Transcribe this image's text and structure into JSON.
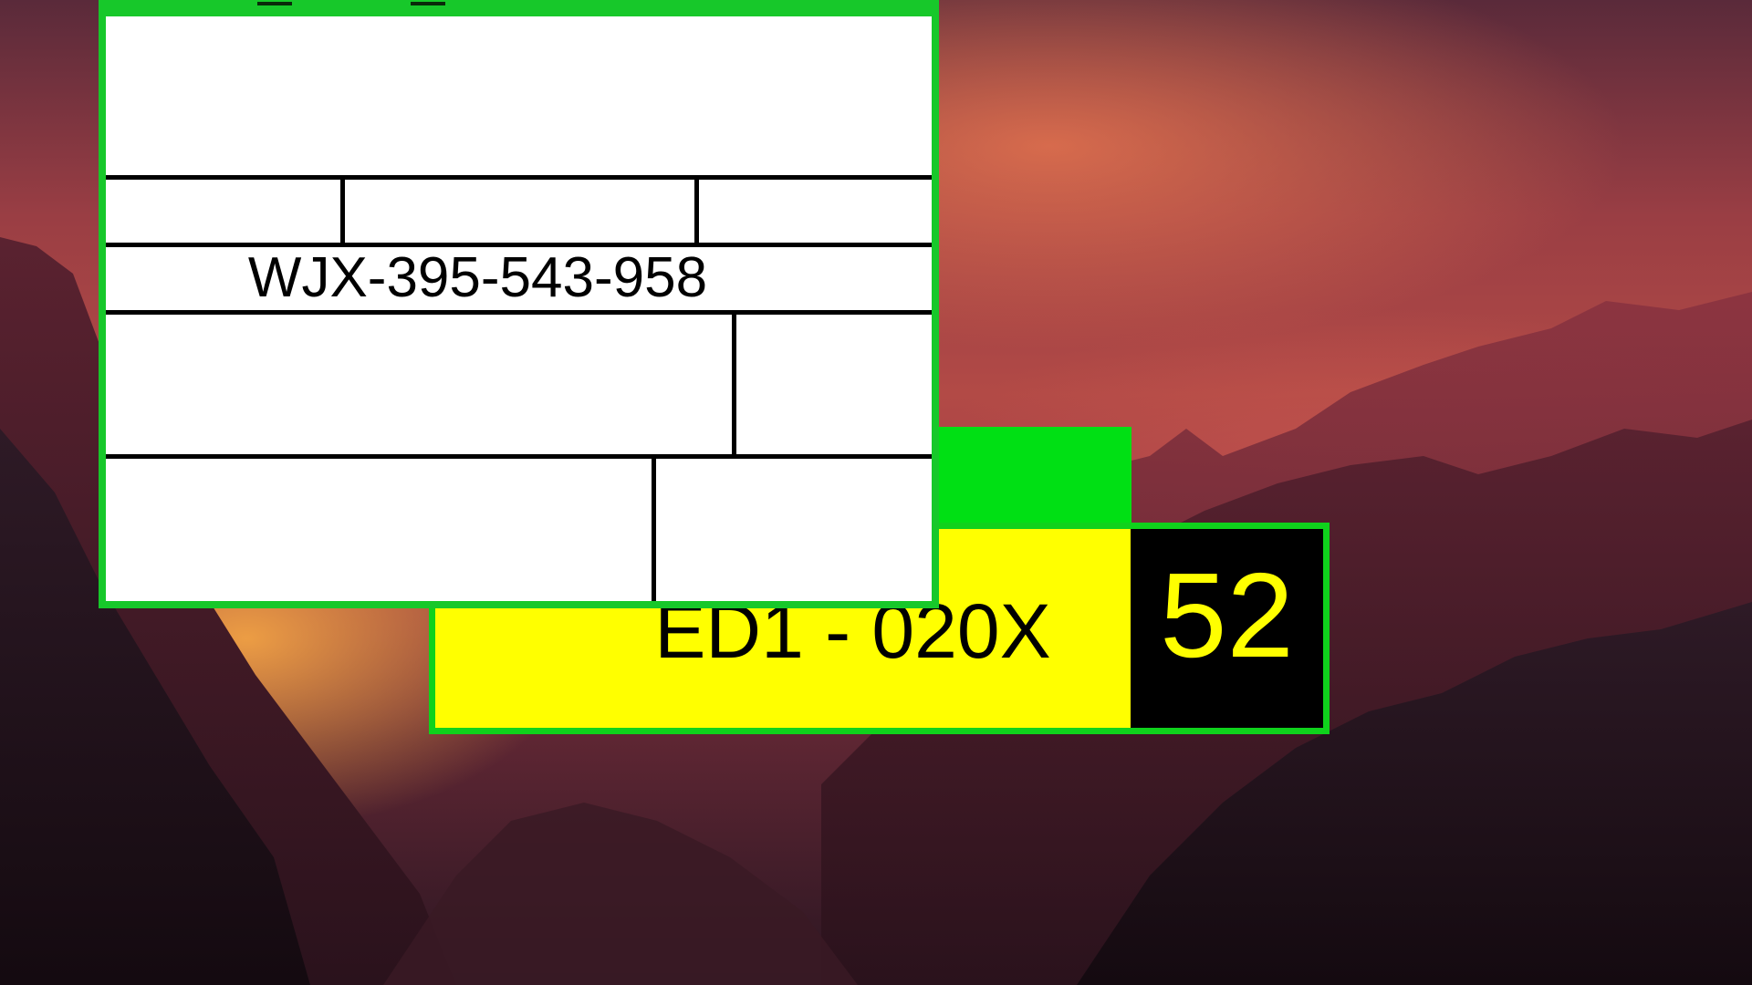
{
  "wallpaper": {
    "description_colors": [
      "#5a2a3a",
      "#b24a46",
      "#ffb046",
      "#2b1622"
    ]
  },
  "plate_window": {
    "code": "ED1 - 020X",
    "number": "52",
    "colors": {
      "frame": "#0fd21c",
      "tab": "#00e014",
      "plate": "#ffff00",
      "number_bg": "#000000",
      "number_fg": "#ffff00"
    }
  },
  "form_window": {
    "id_code": "WJX-395-543-958",
    "colors": {
      "frame": "#17c82a",
      "background": "#ffffff",
      "lines": "#000000"
    }
  }
}
